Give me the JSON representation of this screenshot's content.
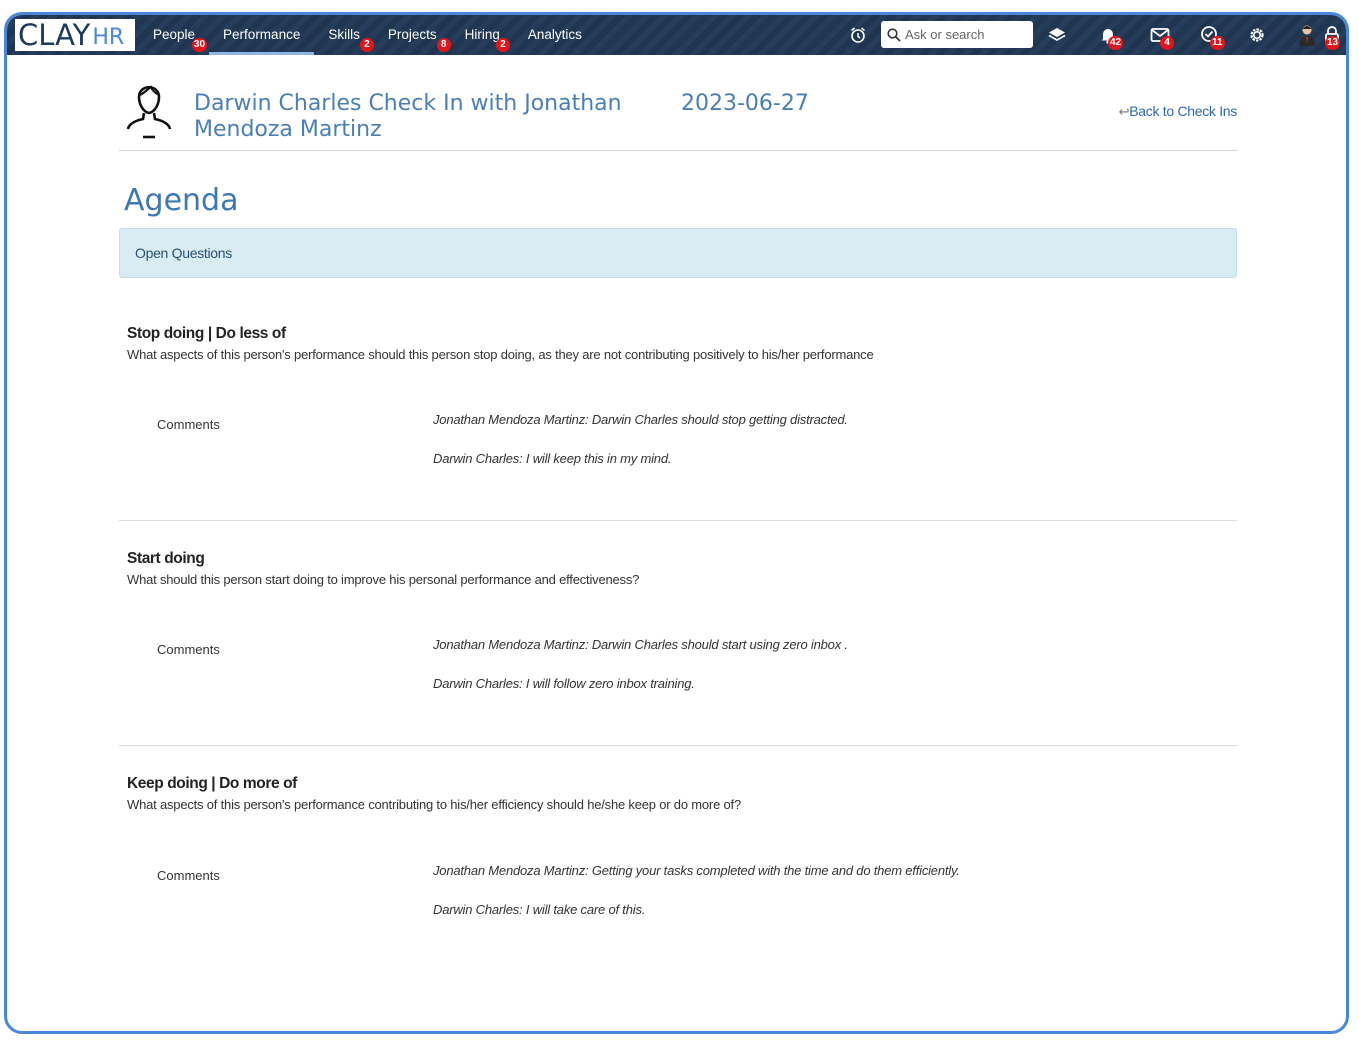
{
  "logo": {
    "clay": "CLAY",
    "hr": "HR"
  },
  "nav": [
    {
      "label": "People",
      "badge": "30"
    },
    {
      "label": "Performance",
      "badge": null
    },
    {
      "label": "Skills",
      "badge": "2"
    },
    {
      "label": "Projects",
      "badge": "8"
    },
    {
      "label": "Hiring",
      "badge": "2"
    },
    {
      "label": "Analytics",
      "badge": null
    }
  ],
  "search": {
    "placeholder": "Ask or search"
  },
  "top_icons": {
    "notifications_badge": "42",
    "messages_badge": "4",
    "approvals_badge": "11",
    "lock_badge": "13"
  },
  "header": {
    "title": "Darwin Charles Check In with Jonathan Mendoza Martinz",
    "date": "2023-06-27",
    "back_link": "Back to Check Ins"
  },
  "agenda": {
    "heading": "Agenda",
    "open_questions": "Open Questions"
  },
  "questions": [
    {
      "title": "Stop doing | Do less of",
      "description": "What aspects of this person's performance should this person stop doing, as they are not contributing positively to his/her performance",
      "comments_label": "Comments",
      "comments": [
        "Jonathan Mendoza Martinz: Darwin Charles should stop getting distracted.",
        "Darwin Charles: I will keep this in my mind."
      ]
    },
    {
      "title": "Start doing",
      "description": "What should this person start doing to improve his personal performance and effectiveness?",
      "comments_label": "Comments",
      "comments": [
        "Jonathan Mendoza Martinz: Darwin Charles should start using zero inbox .",
        "Darwin Charles: I will follow zero inbox training."
      ]
    },
    {
      "title": "Keep doing | Do more of",
      "description": "What aspects of this person's performance contributing to his/her efficiency should he/she keep or do more of?",
      "comments_label": "Comments",
      "comments": [
        "Jonathan Mendoza Martinz: Getting your tasks completed with the time and do them efficiently.",
        "Darwin Charles: I will take care of this."
      ]
    }
  ]
}
